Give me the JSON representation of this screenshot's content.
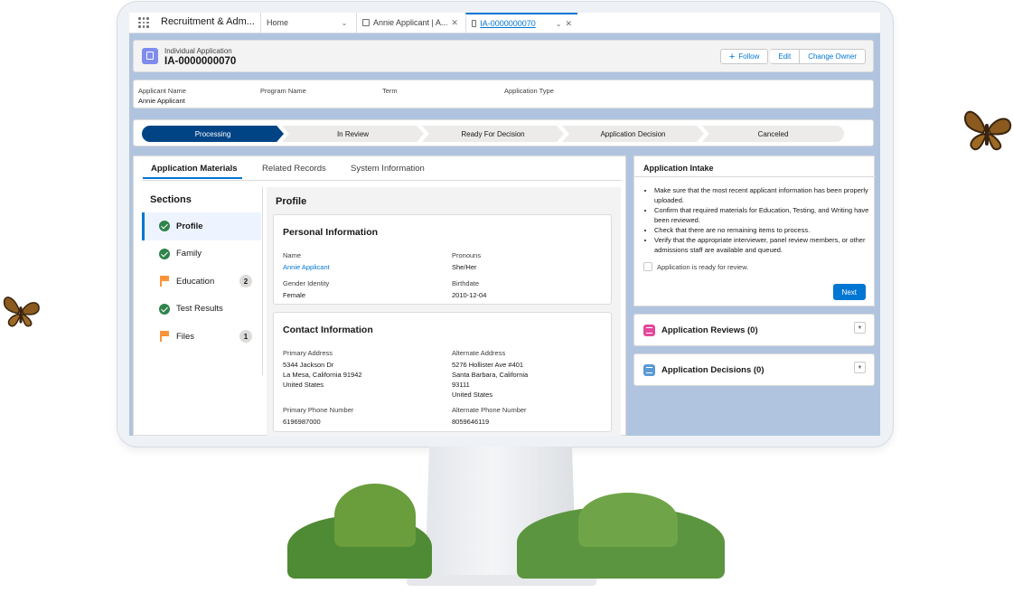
{
  "app": {
    "name": "Recruitment & Adm...",
    "tabs": [
      {
        "label": "Home"
      },
      {
        "label": "Annie Applicant | A..."
      },
      {
        "label": "IA-0000000070"
      }
    ]
  },
  "record": {
    "type_label": "Individual Application",
    "title": "IA-0000000070",
    "actions": {
      "follow": "Follow",
      "edit": "Edit",
      "change_owner": "Change Owner"
    }
  },
  "highlights": [
    {
      "label": "Applicant Name",
      "value": "Annie Applicant"
    },
    {
      "label": "Program Name",
      "value": ""
    },
    {
      "label": "Term",
      "value": ""
    },
    {
      "label": "Application Type",
      "value": ""
    }
  ],
  "path": [
    "Processing",
    "In Review",
    "Ready For Decision",
    "Application Decision",
    "Canceled"
  ],
  "detail_tabs": [
    "Application Materials",
    "Related Records",
    "System Information"
  ],
  "sections": {
    "title": "Sections",
    "items": [
      {
        "label": "Profile",
        "status": "complete",
        "count": ""
      },
      {
        "label": "Family",
        "status": "complete",
        "count": ""
      },
      {
        "label": "Education",
        "status": "flagged",
        "count": "2"
      },
      {
        "label": "Test Results",
        "status": "complete",
        "count": ""
      },
      {
        "label": "Files",
        "status": "flagged",
        "count": "1"
      }
    ]
  },
  "profile": {
    "title": "Profile",
    "personal": {
      "title": "Personal Information",
      "name_label": "Name",
      "name_value": "Annie Applicant",
      "pronouns_label": "Pronouns",
      "pronouns_value": "She/Her",
      "gender_label": "Gender Identity",
      "gender_value": "Female",
      "birthdate_label": "Birthdate",
      "birthdate_value": "2010-12-04"
    },
    "contact": {
      "title": "Contact Information",
      "primary_address_label": "Primary Address",
      "primary_address": [
        "5344 Jackson Dr",
        "La Mesa, California 91942",
        "United States"
      ],
      "alternate_address_label": "Alternate Address",
      "alternate_address": [
        "5276 Hollister Ave #401",
        "Santa Barbara, California",
        "93111",
        "United States"
      ],
      "primary_phone_label": "Primary Phone Number",
      "primary_phone": "6196987000",
      "alternate_phone_label": "Alternate Phone Number",
      "alternate_phone": "8059646119"
    }
  },
  "intake": {
    "title": "Application Intake",
    "items": [
      "Make sure that the most recent applicant information has been properly uploaded.",
      "Confirm that required materials for Education, Testing, and Writing have been reviewed.",
      "Check that there are no remaining items to process.",
      "Verify that the appropriate interviewer, panel review members, or other admissions staff are available and queued."
    ],
    "checkbox_label": "Application is ready for review.",
    "next_label": "Next"
  },
  "related": [
    {
      "title": "Application Reviews (0)",
      "color": "#e3499a"
    },
    {
      "title": "Application Decisions (0)",
      "color": "#5a9ad6"
    }
  ],
  "colors": {
    "brand": "#0176d3",
    "path_active": "#014486",
    "complete": "#2e844a",
    "flag": "#fe9339"
  }
}
